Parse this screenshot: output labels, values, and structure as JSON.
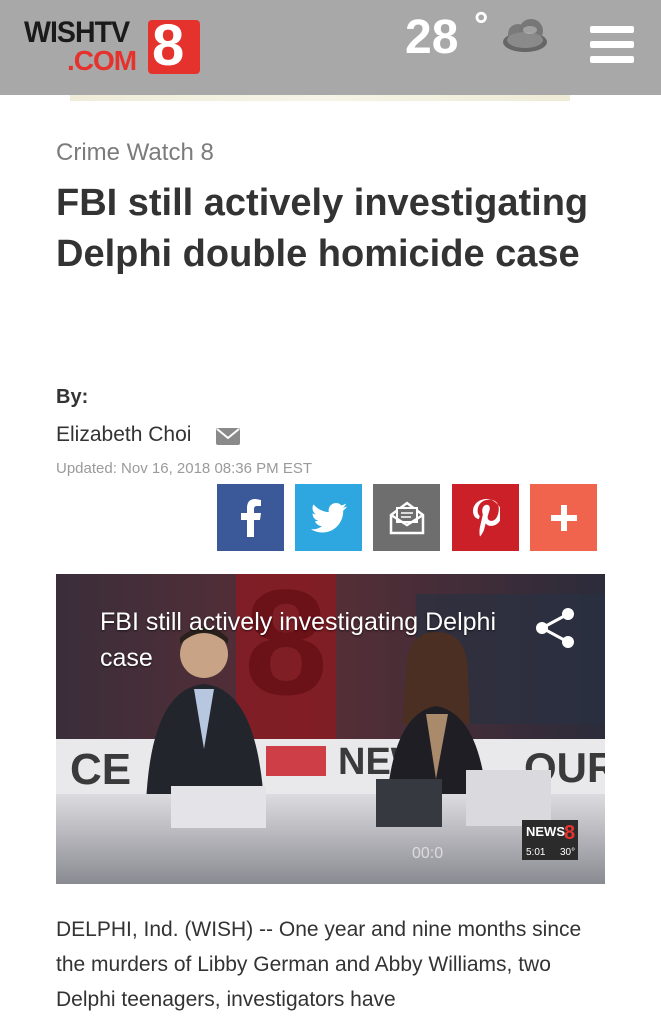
{
  "header": {
    "logo_line1": "WISHTV",
    "logo_line2": ".COM",
    "logo_number": "8",
    "temperature": "28",
    "degree": "°",
    "weather_icon": "cloud-icon",
    "menu_icon": "hamburger-menu-icon"
  },
  "article": {
    "section": "Crime Watch 8",
    "headline": "FBI still actively investigating Delphi double homicide case",
    "by_label": "By:",
    "author": "Elizabeth Choi",
    "updated": "Updated: Nov 16, 2018 08:36 PM EST",
    "body": "DELPHI, Ind. (WISH) -- One year and nine months since the murders of Libby German and Abby Williams, two Delphi teenagers, investigators have"
  },
  "share": {
    "facebook_icon": "facebook-icon",
    "twitter_icon": "twitter-icon",
    "email_icon": "email-icon",
    "pinterest_icon": "pinterest-icon",
    "more_icon": "plus-icon"
  },
  "video": {
    "title": "FBI still actively investigating Delphi case",
    "set_letters_left": "CE",
    "set_letters_mid": "NEW",
    "set_letters_right": "OUR",
    "bug_label": "NEWS",
    "bug_number": "8",
    "bug_time": "5:01",
    "bug_temp": "30°",
    "timecode": "00:0"
  },
  "colors": {
    "header_bg": "#a8a8a8",
    "brand_red": "#e5322d",
    "facebook": "#3b5998",
    "twitter": "#2ea7e0",
    "email": "#6e6e6e",
    "pinterest": "#cb2027",
    "more": "#f0634c"
  }
}
